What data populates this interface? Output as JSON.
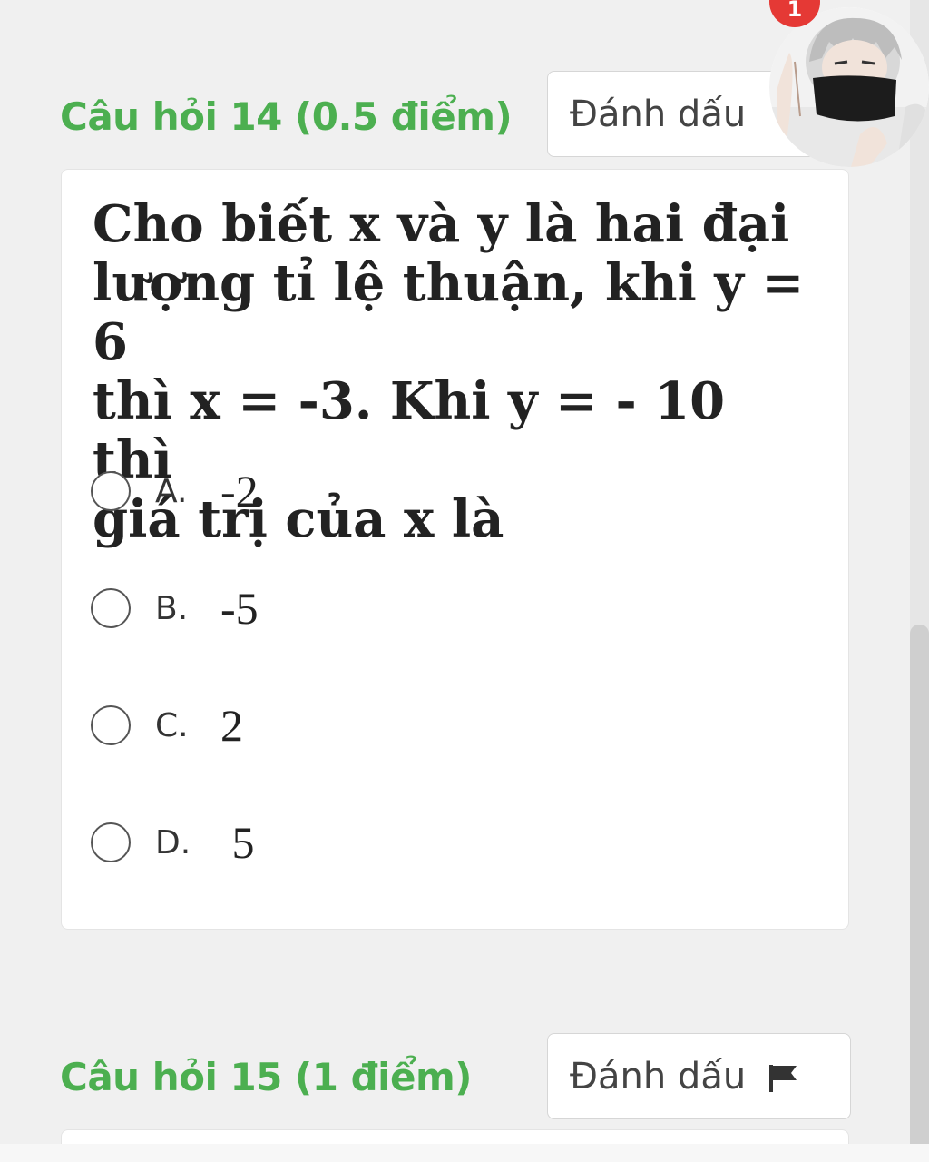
{
  "colors": {
    "accent": "#4caf50",
    "badge": "#e53935",
    "background": "#f0f0f0"
  },
  "notification": {
    "count": "1"
  },
  "avatar": {
    "icon": "anime-character-avatar"
  },
  "question14": {
    "title": "Câu hỏi 14 (0.5 điểm)",
    "flag_label": "Đánh dấu",
    "text_lines": [
      "Cho biết x và y là hai đại",
      "lượng tỉ lệ thuận, khi y = 6",
      "thì x = -3. Khi y = - 10 thì",
      "giá trị của x là"
    ],
    "options": [
      {
        "letter": "A.",
        "value": "-2"
      },
      {
        "letter": "B.",
        "value": "-5"
      },
      {
        "letter": "C.",
        "value": "2"
      },
      {
        "letter": "D.",
        "value": " 5"
      }
    ]
  },
  "question15": {
    "title": "Câu hỏi 15 (1 điểm)",
    "flag_label": "Đánh dấu",
    "flag_icon": "flag-icon"
  }
}
